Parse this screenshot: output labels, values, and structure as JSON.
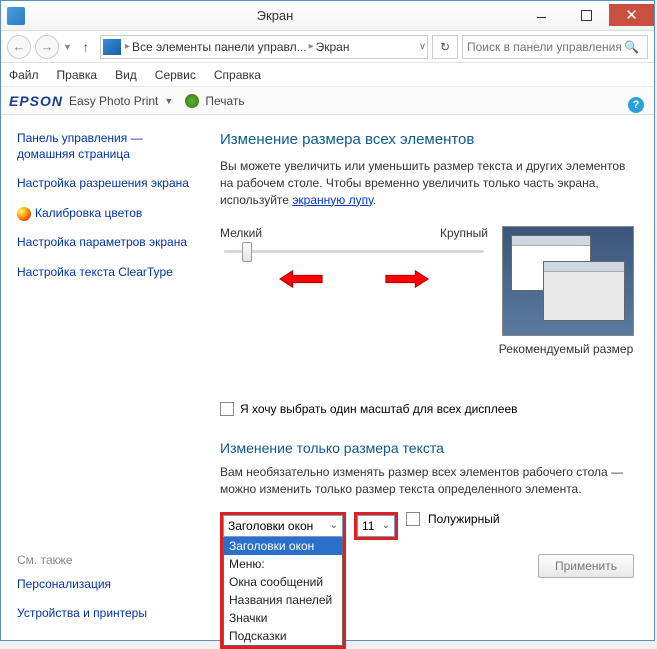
{
  "window": {
    "title": "Экран"
  },
  "nav": {
    "breadcrumb1": "Все элементы панели управл...",
    "breadcrumb2": "Экран",
    "search_placeholder": "Поиск в панели управления"
  },
  "menu": {
    "file": "Файл",
    "edit": "Правка",
    "view": "Вид",
    "service": "Сервис",
    "help": "Справка"
  },
  "epson": {
    "logo": "EPSON",
    "text": "Easy Photo Print",
    "print": "Печать"
  },
  "sidebar": {
    "home": "Панель управления — домашняя страница",
    "resolution": "Настройка разрешения экрана",
    "calibration": "Калибровка цветов",
    "params": "Настройка параметров экрана",
    "cleartype": "Настройка текста ClearType",
    "see_also": "См. также",
    "personalization": "Персонализация",
    "devices": "Устройства и принтеры"
  },
  "main": {
    "heading1": "Изменение размера всех элементов",
    "desc1a": "Вы можете увеличить или уменьшить размер текста и других элементов на рабочем столе. Чтобы временно увеличить только часть экрана, используйте ",
    "desc1_link": "экранную лупу",
    "slider_min": "Мелкий",
    "slider_max": "Крупный",
    "preview_caption": "Рекомендуемый размер",
    "checkbox1": "Я хочу выбрать один масштаб для всех дисплеев",
    "heading2": "Изменение только размера текста",
    "desc2": "Вам необязательно изменять размер всех элементов рабочего стола — можно изменить только размер текста определенного элемента.",
    "element_select": {
      "value": "Заголовки окон",
      "options": [
        "Заголовки окон",
        "Меню:",
        "Окна сообщений",
        "Названия панелей",
        "Значки",
        "Подсказки"
      ]
    },
    "size_value": "11",
    "bold_label": "Полужирный",
    "apply": "Применить"
  }
}
